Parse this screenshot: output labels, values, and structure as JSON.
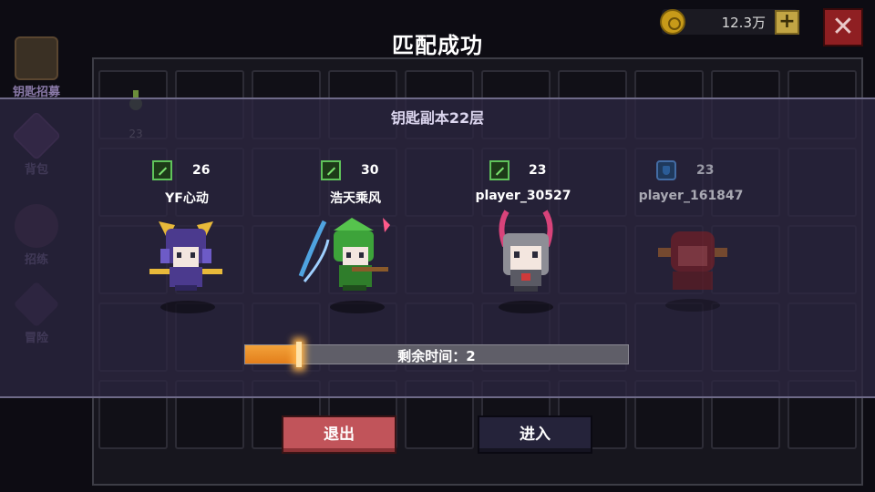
{
  "side_menu": [
    {
      "label": "钥匙招募",
      "color": "#5a4630"
    },
    {
      "label": "背包",
      "color": "#6b3e78"
    },
    {
      "label": "招练",
      "color": "#5c2f55"
    },
    {
      "label": "冒险",
      "color": "#4a2b5e"
    }
  ],
  "currency": {
    "amount": "12.3万",
    "plus": "+",
    "close": "✕"
  },
  "title": "匹配成功",
  "slot_item": {
    "level": "23"
  },
  "subtitle": "钥匙副本22层",
  "players": [
    {
      "name": "YF心动",
      "level": "26",
      "badge": "green",
      "status": "ready"
    },
    {
      "name": "浩天乘风",
      "level": "30",
      "badge": "green",
      "status": "ready"
    },
    {
      "name": "player_30527",
      "level": "23",
      "badge": "green",
      "status": "ready"
    },
    {
      "name": "player_161847",
      "level": "23",
      "badge": "blue",
      "status": "waiting"
    }
  ],
  "progress": {
    "label": "剩余时间：2",
    "fill_fraction": 0.14
  },
  "buttons": {
    "exit": "退出",
    "enter": "进入"
  },
  "colors": {
    "accent": "#e37e1b",
    "exit_button": "#c1545a",
    "enter_button": "#25233a",
    "ready": "#5fc35a",
    "waiting": "#4b7fc0"
  }
}
